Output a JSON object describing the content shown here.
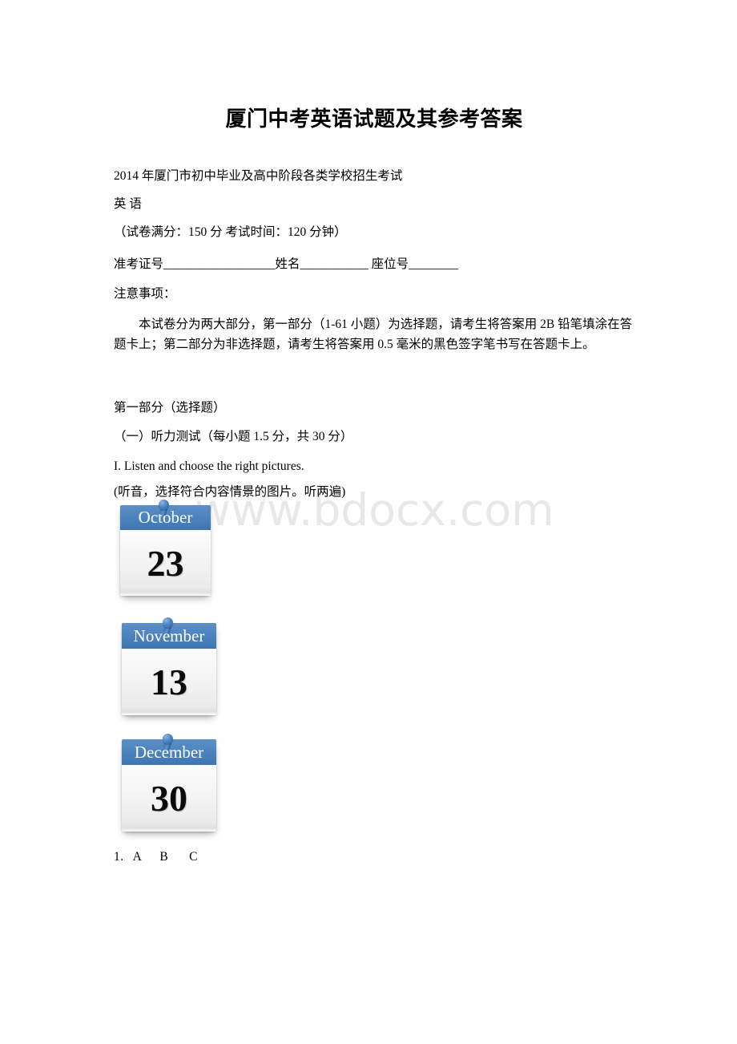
{
  "document": {
    "title": "厦门中考英语试题及其参考答案",
    "watermark": "www.bdocx.com"
  },
  "header_lines": {
    "exam_line": "2014 年厦门市初中毕业及高中阶段各类学校招生考试",
    "subject": "英 语",
    "score_time": "（试卷满分：150 分 考试时间：120 分钟）",
    "candidate_fields": "准考证号__________________姓名___________ 座位号________",
    "notes_label": "注意事项：",
    "notes_body": "本试卷分为两大部分，第一部分（1-61 小题）为选择题，请考生将答案用 2B 铅笔填涂在答题卡上；第二部分为非选择题，请考生将答案用 0.5 毫米的黑色签字笔书写在答题卡上。"
  },
  "section": {
    "part_one": "第一部分（选择题）",
    "listening_header": "（一）听力测试（每小题 1.5 分，共 30 分）",
    "task_en": "I. Listen and choose the right pictures.",
    "task_cn": "(听音，选择符合内容情景的图片。听两遍)"
  },
  "calendars": [
    {
      "month": "October",
      "day": "23",
      "pin": "pushpin-icon"
    },
    {
      "month": "November",
      "day": "13",
      "pin": "pushpin-icon"
    },
    {
      "month": "December",
      "day": "30",
      "pin": "pushpin-icon"
    }
  ],
  "question": {
    "number": "1.",
    "choice_a": "A",
    "choice_b": "B",
    "choice_c": "C"
  },
  "colors": {
    "calendar_header_blue": "#4b82bb",
    "pin_blue": "#2a5f9e",
    "watermark_gray": "#e8e8e8",
    "text_black": "#000000",
    "page_background": "#ffffff"
  }
}
